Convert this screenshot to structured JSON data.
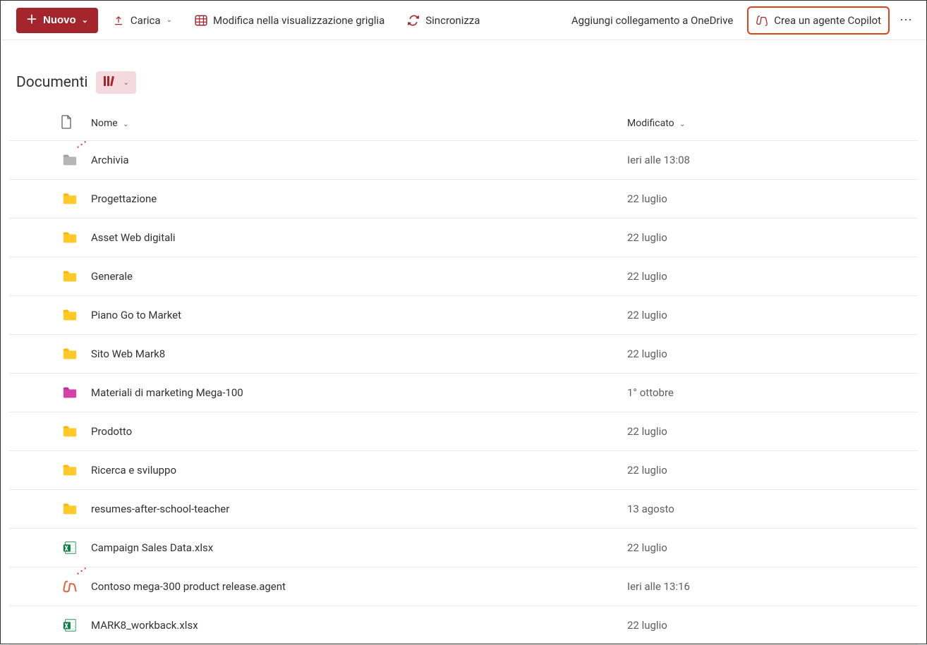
{
  "toolbar": {
    "new_label": "Nuovo",
    "upload_label": "Carica",
    "edit_grid_label": "Modifica nella visualizzazione griglia",
    "sync_label": "Sincronizza",
    "add_onedrive_label": "Aggiungi collegamento a OneDrive",
    "create_copilot_label": "Crea un agente Copilot"
  },
  "page": {
    "title": "Documenti"
  },
  "columns": {
    "name_label": "Nome",
    "modified_label": "Modificato"
  },
  "rows": [
    {
      "icon": "folder-gray",
      "name": "Archivia",
      "modified": "Ieri alle 13:08",
      "is_new": true
    },
    {
      "icon": "folder-yellow",
      "name": "Progettazione",
      "modified": "22 luglio",
      "is_new": false
    },
    {
      "icon": "folder-yellow",
      "name": "Asset Web digitali",
      "modified": "22 luglio",
      "is_new": false
    },
    {
      "icon": "folder-yellow",
      "name": "Generale",
      "modified": "22 luglio",
      "is_new": false
    },
    {
      "icon": "folder-yellow",
      "name": "Piano Go to Market",
      "modified": "22 luglio",
      "is_new": false
    },
    {
      "icon": "folder-yellow",
      "name": "Sito Web Mark8",
      "modified": "22 luglio",
      "is_new": false
    },
    {
      "icon": "folder-pink",
      "name": "Materiali di marketing Mega-100",
      "modified": "1° ottobre",
      "is_new": false
    },
    {
      "icon": "folder-yellow",
      "name": "Prodotto",
      "modified": "22 luglio",
      "is_new": false
    },
    {
      "icon": "folder-yellow",
      "name": "Ricerca e sviluppo",
      "modified": "22 luglio",
      "is_new": false
    },
    {
      "icon": "folder-yellow",
      "name": "resumes-after-school-teacher",
      "modified": "13 agosto",
      "is_new": false
    },
    {
      "icon": "excel",
      "name": "Campaign Sales Data.xlsx",
      "modified": "22 luglio",
      "is_new": false
    },
    {
      "icon": "copilot",
      "name": "Contoso mega-300 product release.agent",
      "modified": "Ieri alle 13:16",
      "is_new": true
    },
    {
      "icon": "excel",
      "name": "MARK8_workback.xlsx",
      "modified": "22 luglio",
      "is_new": false
    }
  ]
}
